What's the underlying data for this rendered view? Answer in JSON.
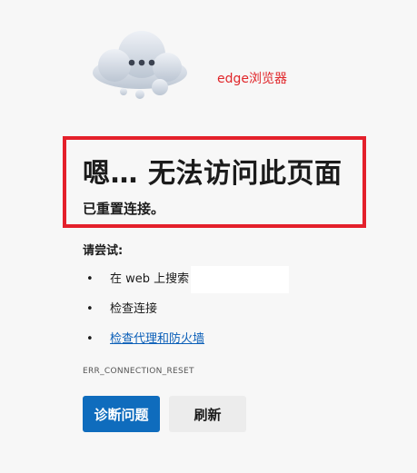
{
  "annotation": "edge浏览器",
  "error": {
    "title": "嗯… 无法访问此页面",
    "subtitle": "已重置连接。",
    "try_label": "请尝试:",
    "suggestions": [
      {
        "text": "在 web 上搜索",
        "link": false
      },
      {
        "text": "检查连接",
        "link": false
      },
      {
        "text": "检查代理和防火墙",
        "link": true
      }
    ],
    "code": "ERR_CONNECTION_RESET"
  },
  "buttons": {
    "diagnose": "诊断问题",
    "refresh": "刷新"
  },
  "colors": {
    "accent": "#0f6cbd",
    "highlight": "#e4202b",
    "link": "#0b5fb8"
  },
  "icons": [
    "cloud-icon"
  ]
}
